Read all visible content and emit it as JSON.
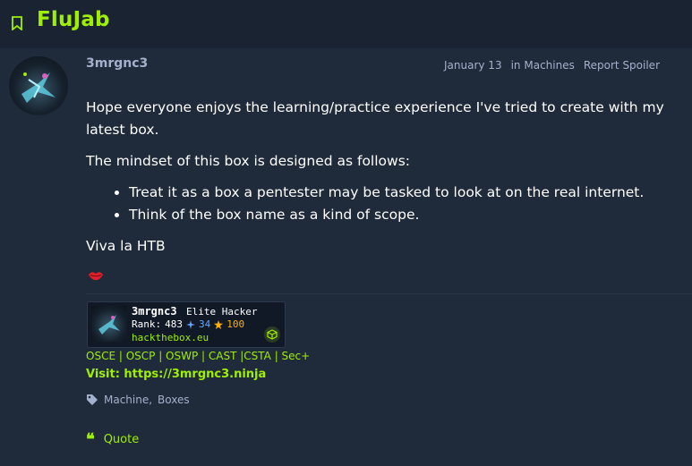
{
  "topic": {
    "title": "FluJab"
  },
  "post": {
    "author": "3mrgnc3",
    "date": "January 13",
    "category_prefix": "in",
    "category": "Machines",
    "report_label": "Report Spoiler",
    "paragraphs": [
      "Hope everyone enjoys the learning/practice experience I've tried to create with my latest box.",
      "The mindset of this box is designed as follows:"
    ],
    "bullets": [
      "Treat it as a box a pentester may be tasked to look at on the real internet.",
      "Think of the box name as a kind of scope."
    ],
    "closing": "Viva la HTB",
    "emoji": "lips-icon"
  },
  "signature": {
    "badge": {
      "name": "3mrgnc3",
      "rank_title": "Elite Hacker",
      "rank_label": "Rank:",
      "rank_value": "483",
      "respect": "34",
      "points": "100",
      "site": "hackthebox.eu"
    },
    "certs": "OSCE | OSCP | OSWP | CAST |CSTA | Sec+",
    "visit": "Visit: https://3mrgnc3.ninja"
  },
  "tags": [
    "Machine,",
    "Boxes"
  ],
  "actions": {
    "quote_label": "Quote"
  },
  "colors": {
    "accent": "#9fef00",
    "background": "#1a2332",
    "post_bg": "#1f2a3a",
    "muted": "#a4b1cd"
  }
}
